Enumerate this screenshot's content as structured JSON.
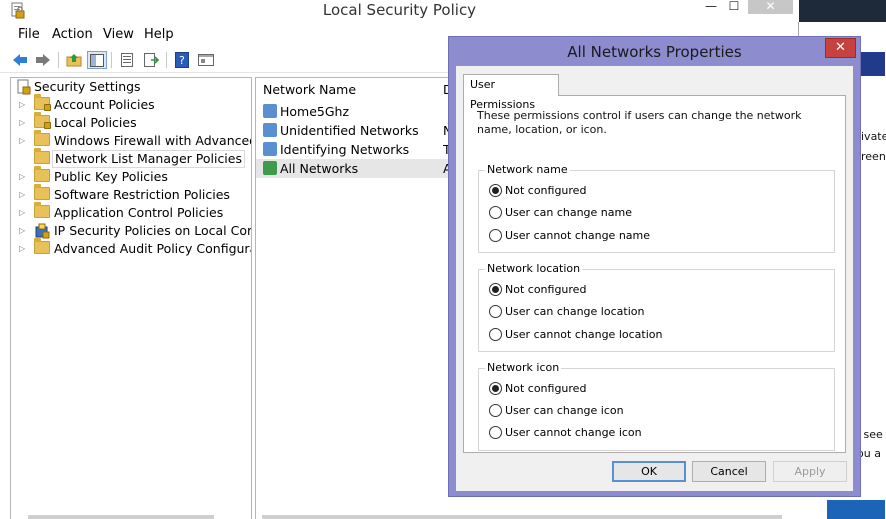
{
  "window": {
    "title": "Local Security Policy",
    "minimize": "—",
    "maximize": "☐",
    "close": "✕"
  },
  "menu": [
    "File",
    "Action",
    "View",
    "Help"
  ],
  "toolbar": [
    "back-icon",
    "forward-icon",
    "up-icon",
    "show-hide-tree-icon",
    "properties-icon",
    "export-icon",
    "help-icon",
    "console-icon"
  ],
  "tree": {
    "items": [
      {
        "label": "Security Settings",
        "expander": ""
      },
      {
        "label": "Account Policies",
        "expander": "▷"
      },
      {
        "label": "Local Policies",
        "expander": "▷"
      },
      {
        "label": "Windows Firewall with Advanced Secu",
        "expander": "▷"
      },
      {
        "label": "Network List Manager Policies",
        "expander": ""
      },
      {
        "label": "Public Key Policies",
        "expander": "▷"
      },
      {
        "label": "Software Restriction Policies",
        "expander": "▷"
      },
      {
        "label": "Application Control Policies",
        "expander": "▷"
      },
      {
        "label": "IP Security Policies on Local Compute",
        "expander": "▷"
      },
      {
        "label": "Advanced Audit Policy Configuration",
        "expander": "▷"
      }
    ]
  },
  "list": {
    "columns": [
      "Network Name",
      "D"
    ],
    "rows": [
      {
        "name": "Home5Ghz",
        "col2": ""
      },
      {
        "name": "Unidentified Networks",
        "col2": "N"
      },
      {
        "name": "Identifying Networks",
        "col2": "T"
      },
      {
        "name": "All Networks",
        "col2": "A"
      }
    ]
  },
  "background_app": {
    "partial_text": [
      "ivate",
      "reen",
      "l see",
      "ou a"
    ]
  },
  "dialog": {
    "title": "All Networks Properties",
    "close": "✕",
    "tab": "User Permissions",
    "description": "These permissions control if users can change the network name, location, or icon.",
    "groups": [
      {
        "label": "Network name",
        "options": [
          "Not configured",
          "User can change name",
          "User cannot change name"
        ],
        "selected": 0
      },
      {
        "label": "Network location",
        "options": [
          "Not configured",
          "User can change location",
          "User cannot change location"
        ],
        "selected": 0
      },
      {
        "label": "Network icon",
        "options": [
          "Not configured",
          "User can change icon",
          "User cannot change icon"
        ],
        "selected": 0
      }
    ],
    "buttons": {
      "ok": "OK",
      "cancel": "Cancel",
      "apply": "Apply"
    }
  },
  "colors": {
    "dialog_frame": "#8c8ccf",
    "close_red": "#c84141",
    "folder": "#e8c15a",
    "accent_blue": "#5b8fd3"
  }
}
